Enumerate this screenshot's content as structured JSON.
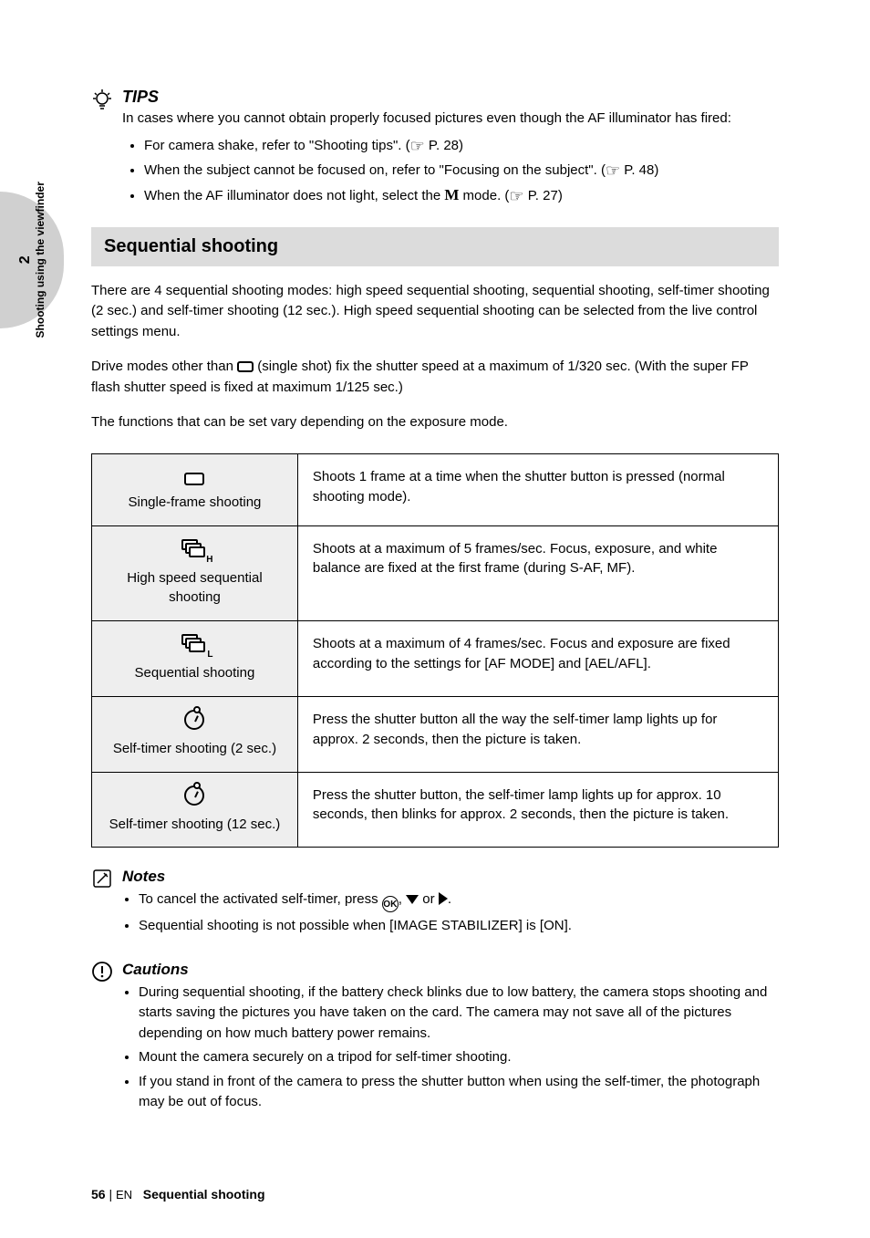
{
  "sideTab": {
    "num": "2",
    "label": "Shooting using the viewfinder"
  },
  "tips": {
    "title": "TIPS",
    "lead": "In cases where you cannot obtain properly focused pictures even though the AF illuminator has fired:",
    "items": [
      {
        "pre": "For camera shake, refer to \"Shooting tips\". (",
        "suf": " P. 28)"
      },
      {
        "pre": "When the subject cannot be focused on, refer to \"Focusing on the subject\". (",
        "suf": " P. 48)"
      },
      {
        "pre": "When the AF illuminator does not light, select the ",
        "boldM": true,
        "mid": " mode. (",
        "suf": " P. 27)"
      }
    ]
  },
  "section": {
    "title": "Sequential shooting"
  },
  "intro": {
    "p1": "There are 4 sequential shooting modes: high speed sequential shooting, sequential shooting, self-timer shooting (2 sec.) and self-timer shooting (12 sec.). High speed sequential shooting can be selected from the live control settings menu.",
    "p2_pre": "Drive modes other than ",
    "p2_mid": " (single shot) fix the shutter speed at a maximum of 1/320 sec. (With the super FP flash shutter speed is fixed at maximum 1/125 sec.)",
    "p3": "The functions that can be set vary depending on the exposure mode."
  },
  "table": {
    "rows": [
      {
        "icon": "single",
        "label": "Single-frame shooting",
        "desc": "Shoots 1 frame at a time when the shutter button is pressed (normal shooting mode)."
      },
      {
        "icon": "burstH",
        "label": "High speed sequential shooting",
        "desc": "Shoots at a maximum of 5 frames/sec. Focus, exposure, and white balance are fixed at the first frame (during S-AF, MF)."
      },
      {
        "icon": "burstL",
        "label": "Sequential shooting",
        "desc": "Shoots at a maximum of 4 frames/sec. Focus and exposure are fixed according to the settings for [AF MODE] and [AEL/AFL]."
      },
      {
        "icon": "timer",
        "label": "Self-timer shooting (2 sec.)",
        "desc": "Press the shutter button all the way the self-timer lamp lights up for approx. 2 seconds, then the picture is taken."
      },
      {
        "icon": "timer",
        "label": "Self-timer shooting (12 sec.)",
        "desc": "Press the shutter button, the self-timer lamp lights up for approx. 10 seconds, then blinks for approx. 2 seconds, then the picture is taken."
      }
    ]
  },
  "notes": {
    "title": "Notes",
    "items": [
      "To cancel the activated self-timer, press Q, G or I.",
      "Sequential shooting is not possible when [IMAGE STABILIZER] is [ON]."
    ]
  },
  "cautions": {
    "title": "Cautions",
    "items": [
      "During sequential shooting, if the battery check blinks due to low battery, the camera stops shooting and starts saving the pictures you have taken on the card. The camera may not save all of the pictures depending on how much battery power remains.",
      "Mount the camera securely on a tripod for self-timer shooting.",
      "If you stand in front of the camera to press the shutter button when using the self-timer, the photograph may be out of focus."
    ]
  },
  "footer": {
    "page": "56",
    "sep": "|",
    "chapter_en": "EN",
    "chapter_title": "Sequential shooting"
  }
}
